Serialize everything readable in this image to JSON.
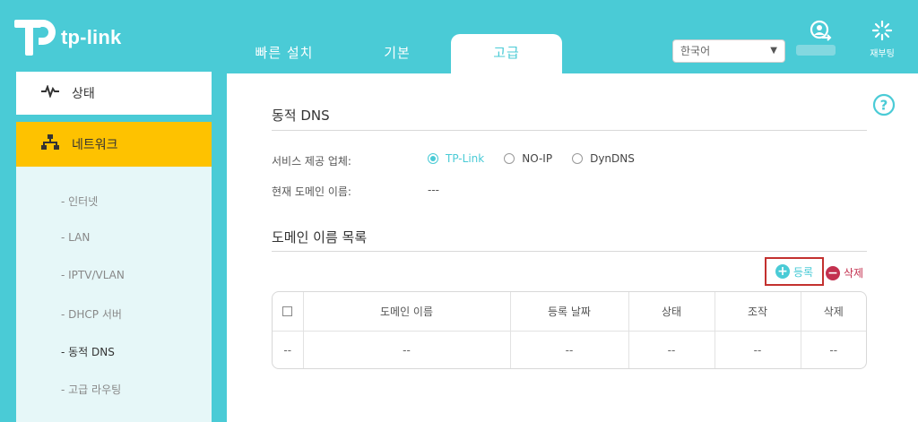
{
  "header": {
    "logo_text": "tp-link",
    "tabs": [
      {
        "label": "빠른 설치"
      },
      {
        "label": "기본"
      },
      {
        "label": "고급"
      }
    ],
    "language_select": {
      "value": "한국어"
    },
    "reboot_label": "재부팅",
    "icons": {
      "logout": "logout-icon",
      "reboot": "reboot-icon"
    }
  },
  "sidebar": {
    "status_label": "상태",
    "network_label": "네트워크",
    "sub_items": [
      {
        "label": "- 인터넷"
      },
      {
        "label": "- LAN"
      },
      {
        "label": "- IPTV/VLAN"
      },
      {
        "label": "- DHCP 서버"
      },
      {
        "label": "- 동적 DNS"
      },
      {
        "label": "- 고급 라우팅"
      }
    ],
    "active_sub": "- 동적 DNS"
  },
  "main": {
    "ddns_title": "동적 DNS",
    "provider_label": "서비스 제공 업체:",
    "providers": [
      {
        "label": "TP-Link",
        "selected": true
      },
      {
        "label": "NO-IP",
        "selected": false
      },
      {
        "label": "DynDNS",
        "selected": false
      }
    ],
    "current_domain_label": "현재 도메인 이름:",
    "current_domain_value": "---",
    "domain_list_title": "도메인 이름 목록",
    "add_label": "등록",
    "delete_label": "삭제",
    "table": {
      "headers": [
        "",
        "도메인 이름",
        "등록 날짜",
        "상태",
        "조작",
        "삭제"
      ],
      "rows": [
        [
          "--",
          "--",
          "--",
          "--",
          "--",
          "--"
        ]
      ]
    }
  },
  "colors": {
    "accent": "#4acbd6",
    "active_menu": "#fec200",
    "highlight_border": "#c3312f",
    "delete": "#c3314f"
  }
}
